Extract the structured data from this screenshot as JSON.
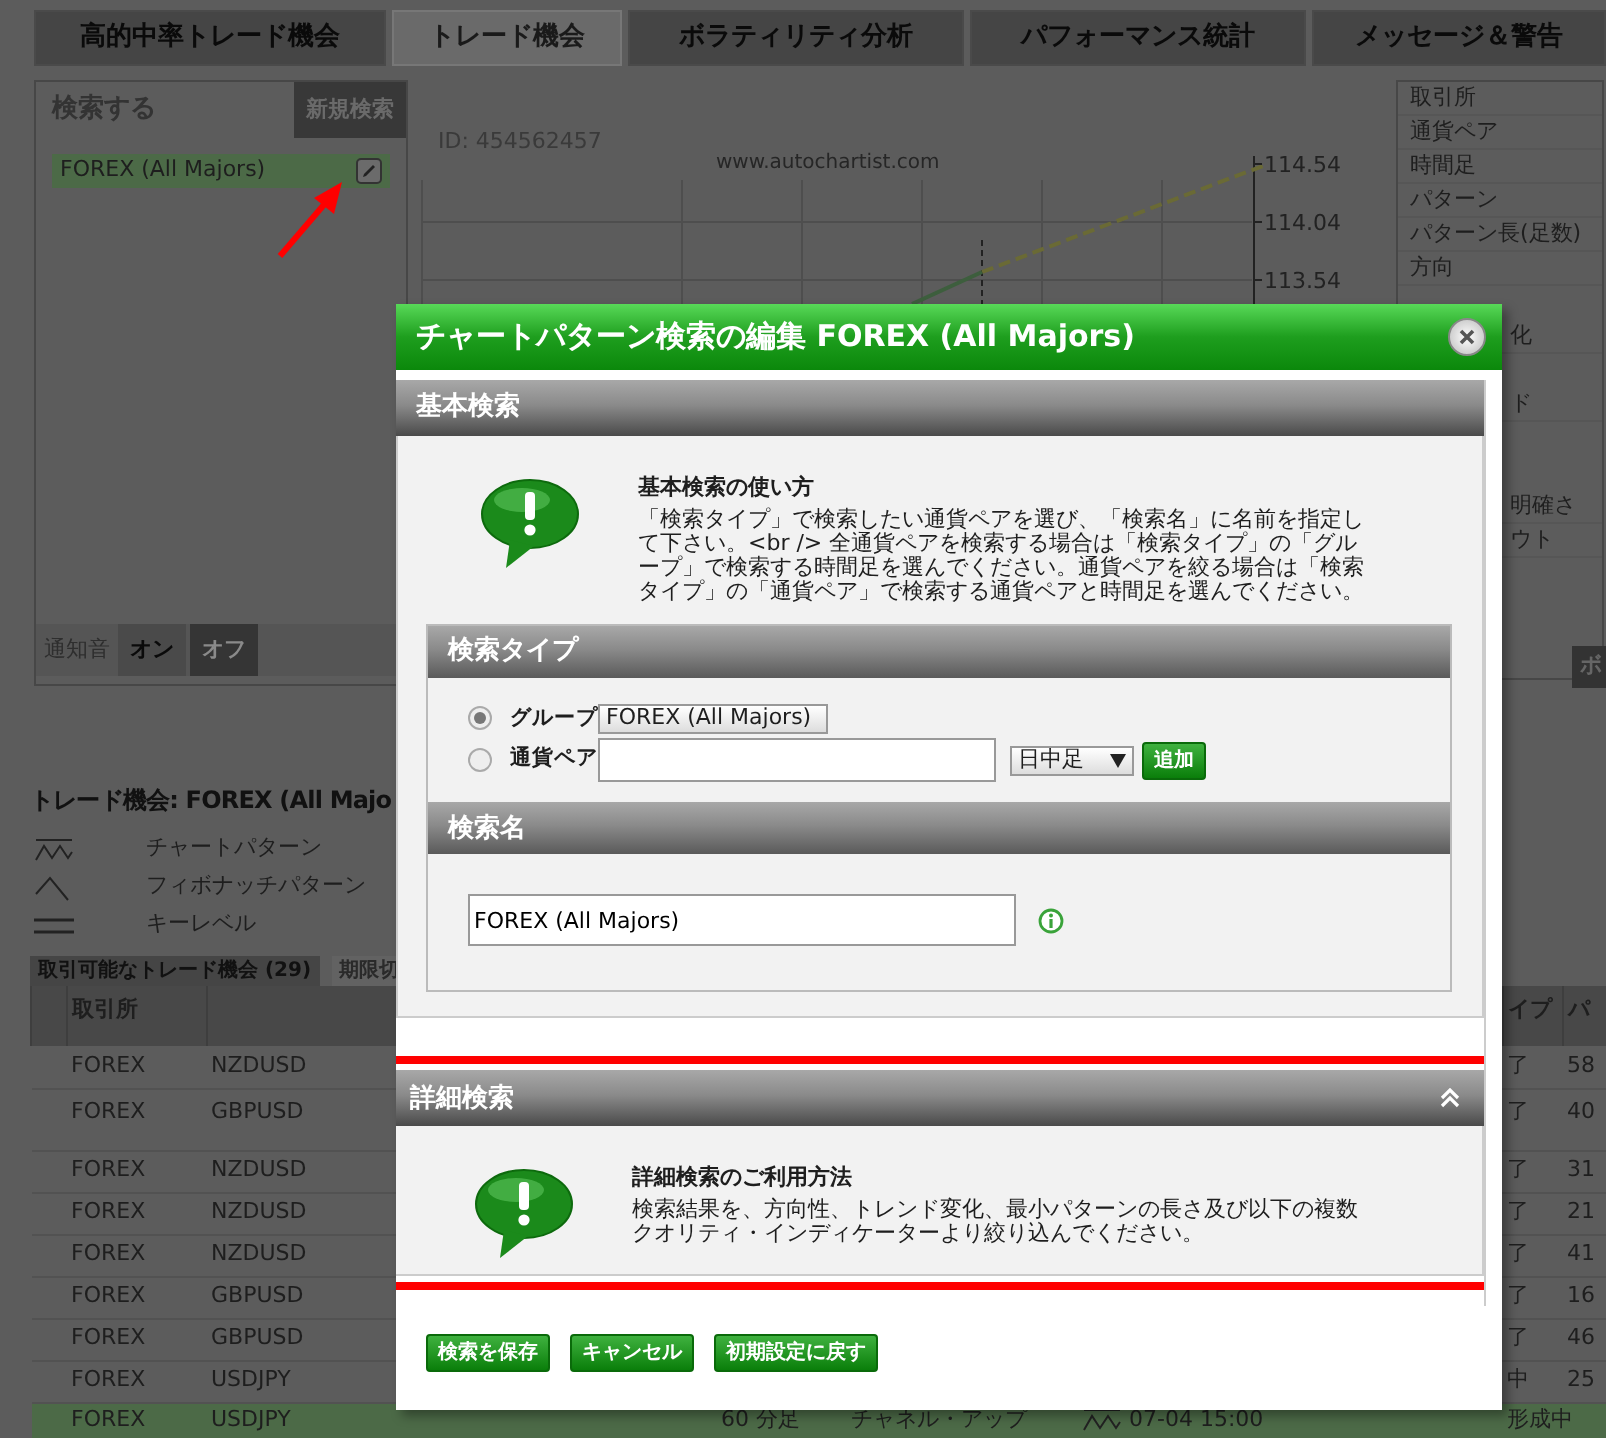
{
  "tabs": [
    {
      "label": "高的中率トレード機会",
      "selected": false
    },
    {
      "label": "トレード機会",
      "selected": true
    },
    {
      "label": "ボラティリティ分析",
      "selected": false
    },
    {
      "label": "パフォーマンス統計",
      "selected": false
    },
    {
      "label": "メッセージ＆警告",
      "selected": false
    }
  ],
  "search_panel": {
    "title": "検索する",
    "new_button": "新規検索",
    "items": [
      {
        "label": "FOREX (All Majors)",
        "selected": true
      }
    ],
    "sound": {
      "label": "通知音",
      "options": [
        {
          "label": "オン",
          "selected": false
        },
        {
          "label": "オフ",
          "selected": true
        }
      ]
    }
  },
  "chart": {
    "id": "ID: 454562457",
    "watermark": "www.autochartist.com",
    "price_labels": [
      "114.54",
      "114.04",
      "113.54"
    ]
  },
  "details_panel": {
    "fields": [
      {
        "label": "取引所"
      },
      {
        "label": "通貨ペア"
      },
      {
        "label": "時間足"
      },
      {
        "label": "パターン"
      },
      {
        "label": "パターン長(足数)"
      },
      {
        "label": "方向"
      },
      {
        "label": "化"
      },
      {
        "label": "ド"
      },
      {
        "label": "明確さ"
      },
      {
        "label": "ウト"
      }
    ],
    "button": "ボ"
  },
  "opportunities": {
    "title": "トレード機会: FOREX (All Majo",
    "legend": [
      {
        "kind": "chart",
        "label": "チャートパターン"
      },
      {
        "kind": "fibonacci",
        "label": "フィボナッチパターン"
      },
      {
        "kind": "key_level",
        "label": "キーレベル"
      }
    ],
    "tabs": [
      {
        "label": "取引可能なトレード機会 (29)",
        "selected": true
      },
      {
        "label": "期限切",
        "selected": false
      }
    ],
    "columns": {
      "exchange": "取引所",
      "column_7": "イプ",
      "column_8": "パ"
    },
    "rows": [
      {
        "exchange": "FOREX",
        "pair": "NZDUSD",
        "column_7": "了",
        "column_8": "58",
        "selected": false
      },
      {
        "exchange": "FOREX",
        "pair": "GBPUSD",
        "column_7": "了",
        "column_8": "40",
        "selected": false
      },
      {
        "exchange": "FOREX",
        "pair": "NZDUSD",
        "column_7": "了",
        "column_8": "31",
        "selected": false
      },
      {
        "exchange": "FOREX",
        "pair": "NZDUSD",
        "column_7": "了",
        "column_8": "21",
        "selected": false
      },
      {
        "exchange": "FOREX",
        "pair": "NZDUSD",
        "column_7": "了",
        "column_8": "41",
        "selected": false
      },
      {
        "exchange": "FOREX",
        "pair": "GBPUSD",
        "column_7": "了",
        "column_8": "16",
        "selected": false
      },
      {
        "exchange": "FOREX",
        "pair": "GBPUSD",
        "column_7": "了",
        "column_8": "46",
        "selected": false
      },
      {
        "exchange": "FOREX",
        "pair": "USDJPY",
        "column_7": "中",
        "column_8": "25",
        "selected": false
      },
      {
        "exchange": "FOREX",
        "pair": "USDJPY",
        "timeframe": "60 分足",
        "pattern": "チャネル・アップ",
        "kind": "chart",
        "time": "07-04 15:00",
        "column_7": "形成中",
        "selected": true
      }
    ]
  },
  "modal": {
    "title": "チャートパターン検索の編集 FOREX (All Majors)",
    "sections": [
      {
        "kind": "basic",
        "title": "基本検索",
        "highlighted": false,
        "help_title": "基本検索の使い方",
        "help_text": "「検索タイプ」で検索したい通貨ペアを選び、「検索名」に名前を指定して下さい。<br /> 全通貨ペアを検索する場合は「検索タイプ」の「グループ」で検索する時間足を選んでください。通貨ペアを絞る場合は「検索タイプ」の「通貨ペア」で検索する通貨ペアと時間足を選んでください。",
        "search_type": {
          "title": "検索タイプ",
          "options": [
            {
              "kind": "group",
              "label": "グループ",
              "selected": true,
              "select_value": "FOREX (All Majors)"
            },
            {
              "kind": "pair",
              "label": "通貨ペア",
              "selected": false,
              "timeframe": "日中足",
              "add_button": "追加"
            }
          ]
        },
        "search_name": {
          "title": "検索名",
          "value": "FOREX (All Majors)"
        }
      },
      {
        "kind": "advanced",
        "title": "詳細検索",
        "highlighted": true,
        "help_title": "詳細検索のご利用方法",
        "help_text": "検索結果を、方向性、トレンド変化、最小パターンの長さ及び以下の複数クオリティ・インディケーターより絞り込んでください。"
      }
    ],
    "buttons": [
      "検索を保存",
      "キャンセル",
      "初期設定に戻す"
    ]
  }
}
